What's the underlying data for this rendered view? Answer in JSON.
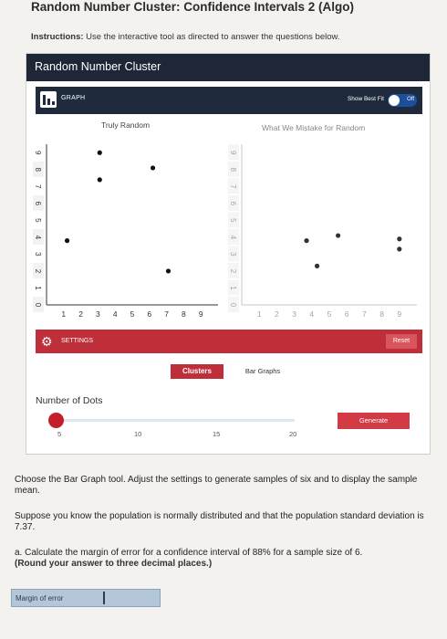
{
  "page": {
    "title": "Random Number Cluster: Confidence Intervals 2 (Algo)",
    "instructions_bold": "Instructions:",
    "instructions_text": " Use the interactive tool as directed to answer the questions below."
  },
  "tool": {
    "header": "Random Number Cluster",
    "graph_label": "GRAPH",
    "best_fit_label": "Show Best Fit",
    "toggle_state": "Off",
    "left_plot_title": "Truly Random",
    "right_plot_title": "What We Mistake for Random",
    "settings_label": "SETTINGS",
    "reset_label": "Reset",
    "tab_clusters": "Clusters",
    "tab_bar_graphs": "Bar Graphs",
    "dots_label": "Number of Dots",
    "slider_value": 5,
    "slider_range": [
      5,
      20
    ],
    "slider_ticks": [
      "5",
      "10",
      "15",
      "20"
    ],
    "generate_label": "Generate",
    "accent_colors": {
      "header": "#1f2638",
      "settings": "#bf2f3a",
      "toggle": "#1c4f9c"
    }
  },
  "chart_data": [
    {
      "type": "scatter",
      "title": "Truly Random",
      "x_ticks": [
        "1",
        "2",
        "3",
        "4",
        "5",
        "6",
        "7",
        "8",
        "9"
      ],
      "y_ticks": [
        "0",
        "1",
        "2",
        "3",
        "4",
        "5",
        "6",
        "7",
        "8",
        "9"
      ],
      "xlim": [
        0,
        10
      ],
      "ylim": [
        0,
        9.5
      ],
      "points": [
        {
          "x": 3.1,
          "y": 9.0
        },
        {
          "x": 3.1,
          "y": 7.4
        },
        {
          "x": 6.2,
          "y": 8.1
        },
        {
          "x": 1.2,
          "y": 3.8
        },
        {
          "x": 7.1,
          "y": 2.0
        }
      ]
    },
    {
      "type": "scatter",
      "title": "What We Mistake for Random",
      "x_ticks": [
        "1",
        "2",
        "3",
        "4",
        "5",
        "6",
        "7",
        "8",
        "9"
      ],
      "y_ticks": [
        "0",
        "1",
        "2",
        "3",
        "4",
        "5",
        "6",
        "7",
        "8",
        "9"
      ],
      "xlim": [
        0,
        10
      ],
      "ylim": [
        0,
        9.5
      ],
      "points": [
        {
          "x": 3.7,
          "y": 3.8
        },
        {
          "x": 5.5,
          "y": 4.1
        },
        {
          "x": 4.3,
          "y": 2.3
        },
        {
          "x": 9.0,
          "y": 3.9
        },
        {
          "x": 9.0,
          "y": 3.3
        }
      ]
    }
  ],
  "question": {
    "intro": "Choose the Bar Graph tool. Adjust the settings to generate samples of six and to display the sample mean.",
    "given": "Suppose you know the population is normally distributed and that the population standard deviation is 7.37.",
    "part_a": "a. Calculate the margin of error for a confidence interval of 88% for a sample size of 6.",
    "part_a_note": "(Round your answer to three decimal places.)",
    "answer_label": "Margin of error",
    "answer_value": ""
  }
}
